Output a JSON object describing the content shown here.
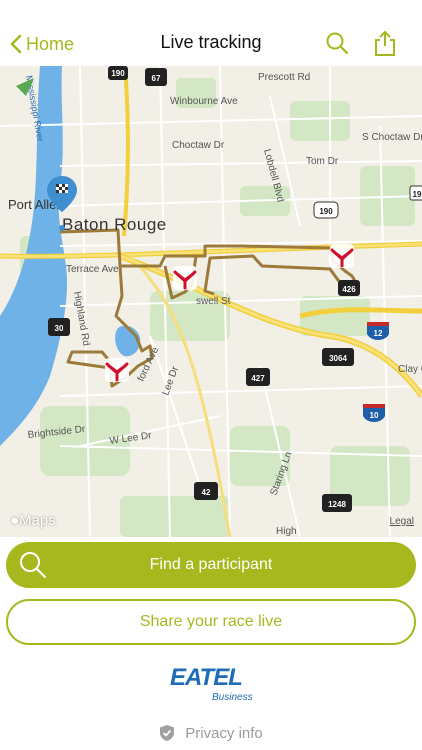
{
  "nav": {
    "back_label": "Home",
    "title": "Live tracking",
    "search_icon": "search-icon",
    "share_icon": "share-icon"
  },
  "map": {
    "labels": {
      "prescott": "Prescott Rd",
      "winbourne": "Winbourne Ave",
      "choctaw": "Choctaw Dr",
      "s_choctaw": "S Choctaw Dr",
      "tom": "Tom Dr",
      "lobdell": "Lobdell Blvd",
      "port_allen": "Port Allen",
      "baton_rouge": "Baton Rouge",
      "terrace": "Terrace Ave",
      "highland": "Highland Rd",
      "lee": "Lee Dr",
      "w_lee": "W Lee Dr",
      "brightside": "Brightside Dr",
      "staring": "Staring Ln",
      "clay": "Clay Cu",
      "river": "Mississippi River",
      "swell": "swell St",
      "stanford": "ford Ave",
      "hig": "High"
    },
    "shields": {
      "s190a": "190",
      "s67": "67",
      "s190b": "190",
      "s19": "19",
      "s30": "30",
      "s426": "426",
      "s12": "12",
      "s3064": "3064",
      "s427": "427",
      "s10": "10",
      "s42": "42",
      "s1248": "1248"
    },
    "brand": "Maps",
    "legal": "Legal",
    "route_color": "#9c7a3a",
    "marker_color": "#d0102e"
  },
  "actions": {
    "find_label": "Find a participant",
    "share_label": "Share your race live"
  },
  "sponsor": {
    "name": "EATEL",
    "sub": "Business"
  },
  "privacy": {
    "label": "Privacy info",
    "icon": "shield-check-icon"
  }
}
